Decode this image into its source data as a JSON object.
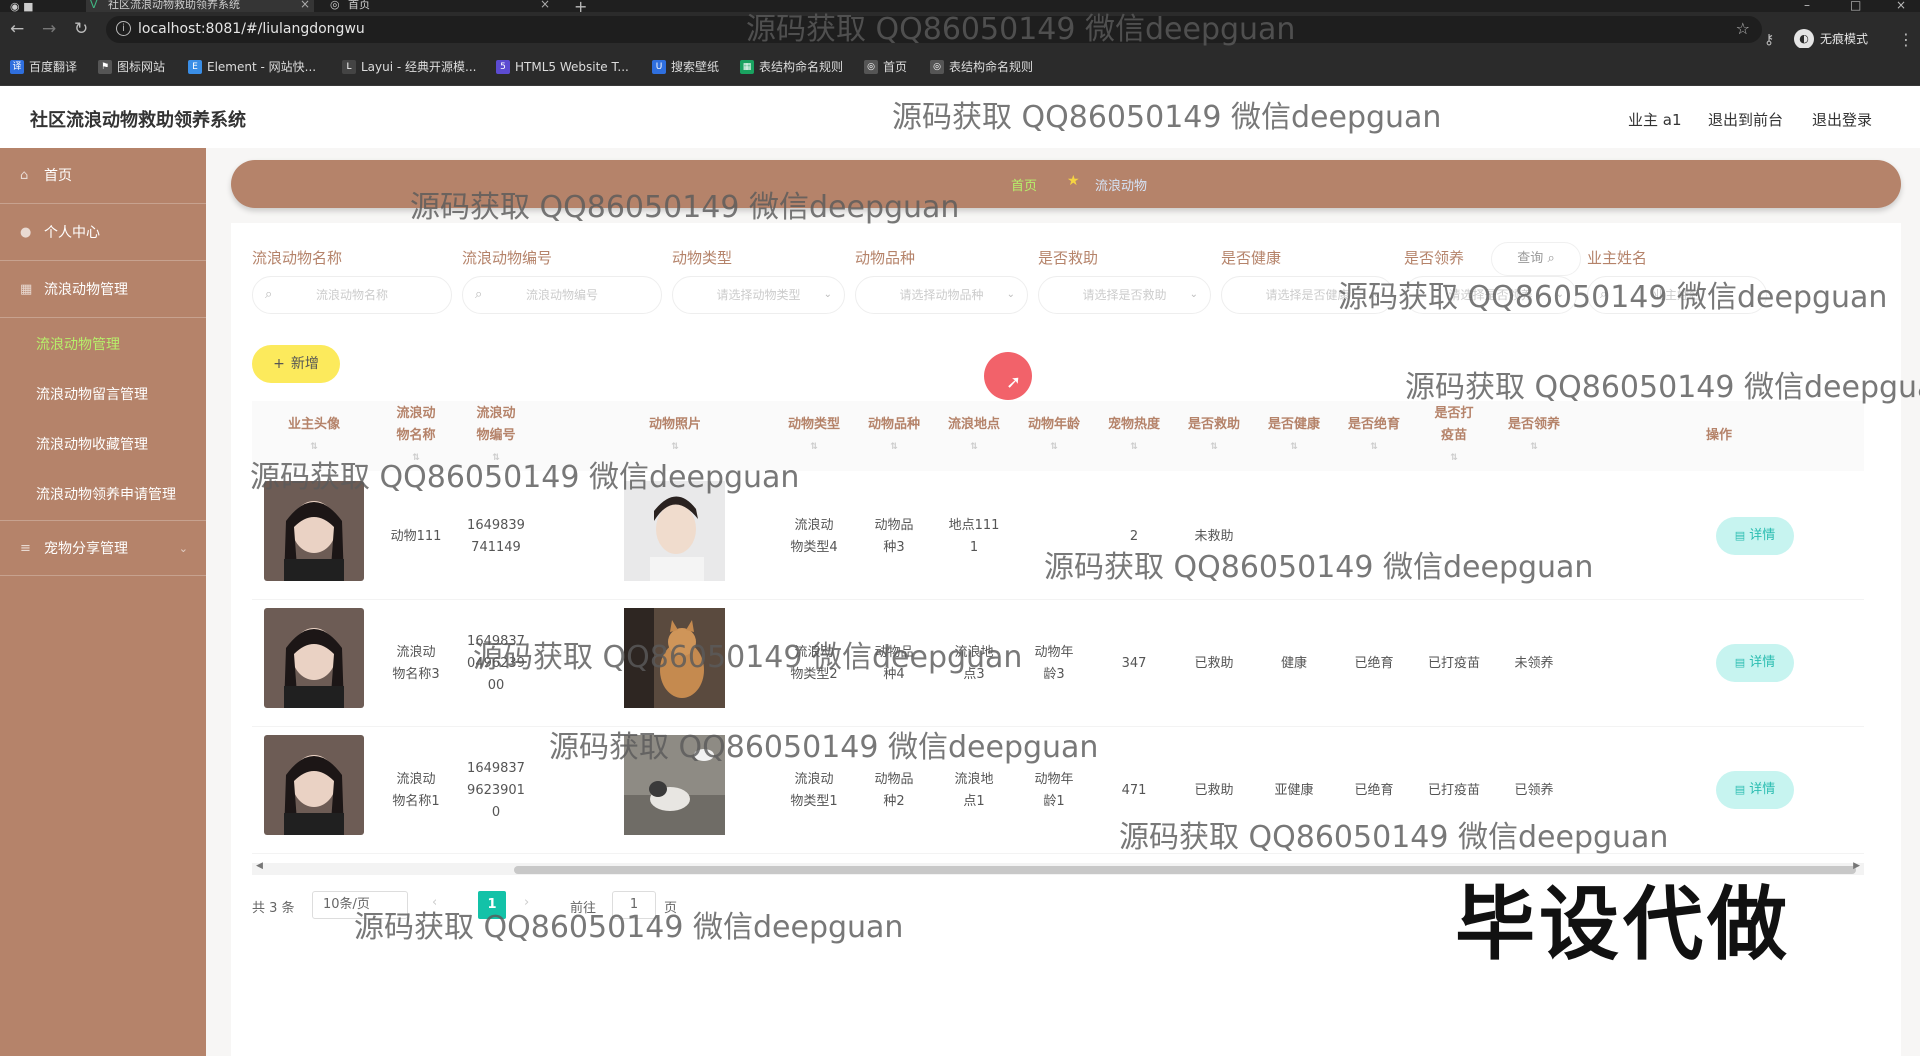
{
  "browser": {
    "tabs": [
      {
        "label": "社区流浪动物救助领养系统",
        "active": true
      },
      {
        "label": "首页",
        "active": false
      }
    ],
    "url": "localhost:8081/#/liulangdongwu",
    "profile_label": "无痕模式",
    "bookmarks": [
      {
        "label": "百度翻译",
        "icon": "translate-icon",
        "color": "#2f6fde"
      },
      {
        "label": "图标网站",
        "icon": "flag-icon",
        "color": "#555555"
      },
      {
        "label": "Element - 网站快...",
        "icon": "element-icon",
        "color": "#3a8ee6"
      },
      {
        "label": "Layui - 经典开源模...",
        "icon": "layui-icon",
        "color": "#444444"
      },
      {
        "label": "HTML5 Website T...",
        "icon": "html5-icon",
        "color": "#5c4bd1"
      },
      {
        "label": "搜索壁纸",
        "icon": "wallpaper-icon",
        "color": "#2f6fde"
      },
      {
        "label": "表结构命名规则",
        "icon": "table-icon",
        "color": "#1aa260"
      },
      {
        "label": "首页",
        "icon": "globe-icon",
        "color": "#555555"
      },
      {
        "label": "表结构命名规则",
        "icon": "globe-icon",
        "color": "#555555"
      }
    ]
  },
  "header": {
    "title": "社区流浪动物救助领养系统",
    "user_label": "业主 a1",
    "front_label": "退出到前台",
    "logout_label": "退出登录"
  },
  "sidebar": {
    "items": [
      {
        "label": "首页",
        "icon": "home-icon",
        "type": "top"
      },
      {
        "label": "个人中心",
        "icon": "user-icon",
        "type": "top"
      },
      {
        "label": "流浪动物管理",
        "icon": "grid-icon",
        "type": "top"
      },
      {
        "label": "流浪动物管理",
        "type": "sub",
        "active": true
      },
      {
        "label": "流浪动物留言管理",
        "type": "sub"
      },
      {
        "label": "流浪动物收藏管理",
        "type": "sub"
      },
      {
        "label": "流浪动物领养申请管理",
        "type": "sub"
      },
      {
        "label": "宠物分享管理",
        "icon": "menu-icon",
        "type": "top"
      }
    ]
  },
  "breadcrumb": {
    "home": "首页",
    "current": "流浪动物"
  },
  "filters": [
    {
      "label": "流浪动物名称",
      "placeholder": "流浪动物名称",
      "kind": "text"
    },
    {
      "label": "流浪动物编号",
      "placeholder": "流浪动物编号",
      "kind": "text"
    },
    {
      "label": "动物类型",
      "placeholder": "请选择动物类型",
      "kind": "select"
    },
    {
      "label": "动物品种",
      "placeholder": "请选择动物品种",
      "kind": "select"
    },
    {
      "label": "是否救助",
      "placeholder": "请选择是否救助",
      "kind": "select"
    },
    {
      "label": "是否健康",
      "placeholder": "请选择是否健康",
      "kind": "select"
    },
    {
      "label": "是否领养",
      "placeholder": "请选择是否领养",
      "kind": "select"
    },
    {
      "label": "业主姓名",
      "placeholder": "业主姓名",
      "kind": "text"
    }
  ],
  "query_label": "查询",
  "add_label": "新增",
  "table": {
    "columns": [
      {
        "label": "业主头像"
      },
      {
        "label": "流浪动物名称"
      },
      {
        "label": "流浪动物编号"
      },
      {
        "label": "动物照片"
      },
      {
        "label": "动物类型"
      },
      {
        "label": "动物品种"
      },
      {
        "label": "流浪地点"
      },
      {
        "label": "动物年龄"
      },
      {
        "label": "宠物热度"
      },
      {
        "label": "是否救助"
      },
      {
        "label": "是否健康"
      },
      {
        "label": "是否绝育"
      },
      {
        "label": "是否打疫苗"
      },
      {
        "label": "是否领养"
      },
      {
        "label": "操作"
      }
    ],
    "detail_label": "详情",
    "rows": [
      {
        "name": "动物111",
        "code": "1649839741149",
        "type": "流浪动物类型4",
        "breed": "动物品种3",
        "place": "地点1111",
        "age": "",
        "heat": "2",
        "rescued": "未救助",
        "healthy": "",
        "neutered": "",
        "vaccinated": "",
        "adopted": "",
        "photo": "man"
      },
      {
        "name": "流浪动物名称3",
        "code": "1649837049623900",
        "type": "流浪动物类型2",
        "breed": "动物品种4",
        "place": "流浪地点3",
        "age": "动物年龄3",
        "heat": "347",
        "rescued": "已救助",
        "healthy": "健康",
        "neutered": "已绝育",
        "vaccinated": "已打疫苗",
        "adopted": "未领养",
        "photo": "cat"
      },
      {
        "name": "流浪动物名称1",
        "code": "16498379623901 0",
        "type": "流浪动物类型1",
        "breed": "动物品种2",
        "place": "流浪地点1",
        "age": "动物年龄1",
        "heat": "471",
        "rescued": "已救助",
        "healthy": "亚健康",
        "neutered": "已绝育",
        "vaccinated": "已打疫苗",
        "adopted": "已领养",
        "photo": "dog"
      }
    ]
  },
  "pagination": {
    "total_label": "共 3 条",
    "page_size_label": "10条/页",
    "current_page": "1",
    "goto_label": "前往",
    "goto_value": "1",
    "unit_label": "页"
  },
  "watermarks": {
    "text": "源码获取 QQ86050149 微信deepguan",
    "big": "毕设代做"
  },
  "colors": {
    "accent": "#b5836a",
    "active_menu": "#b7f06a",
    "add_button": "#fcea5c",
    "detail_button": "#c7f4f0",
    "page_active": "#13c2a8"
  }
}
